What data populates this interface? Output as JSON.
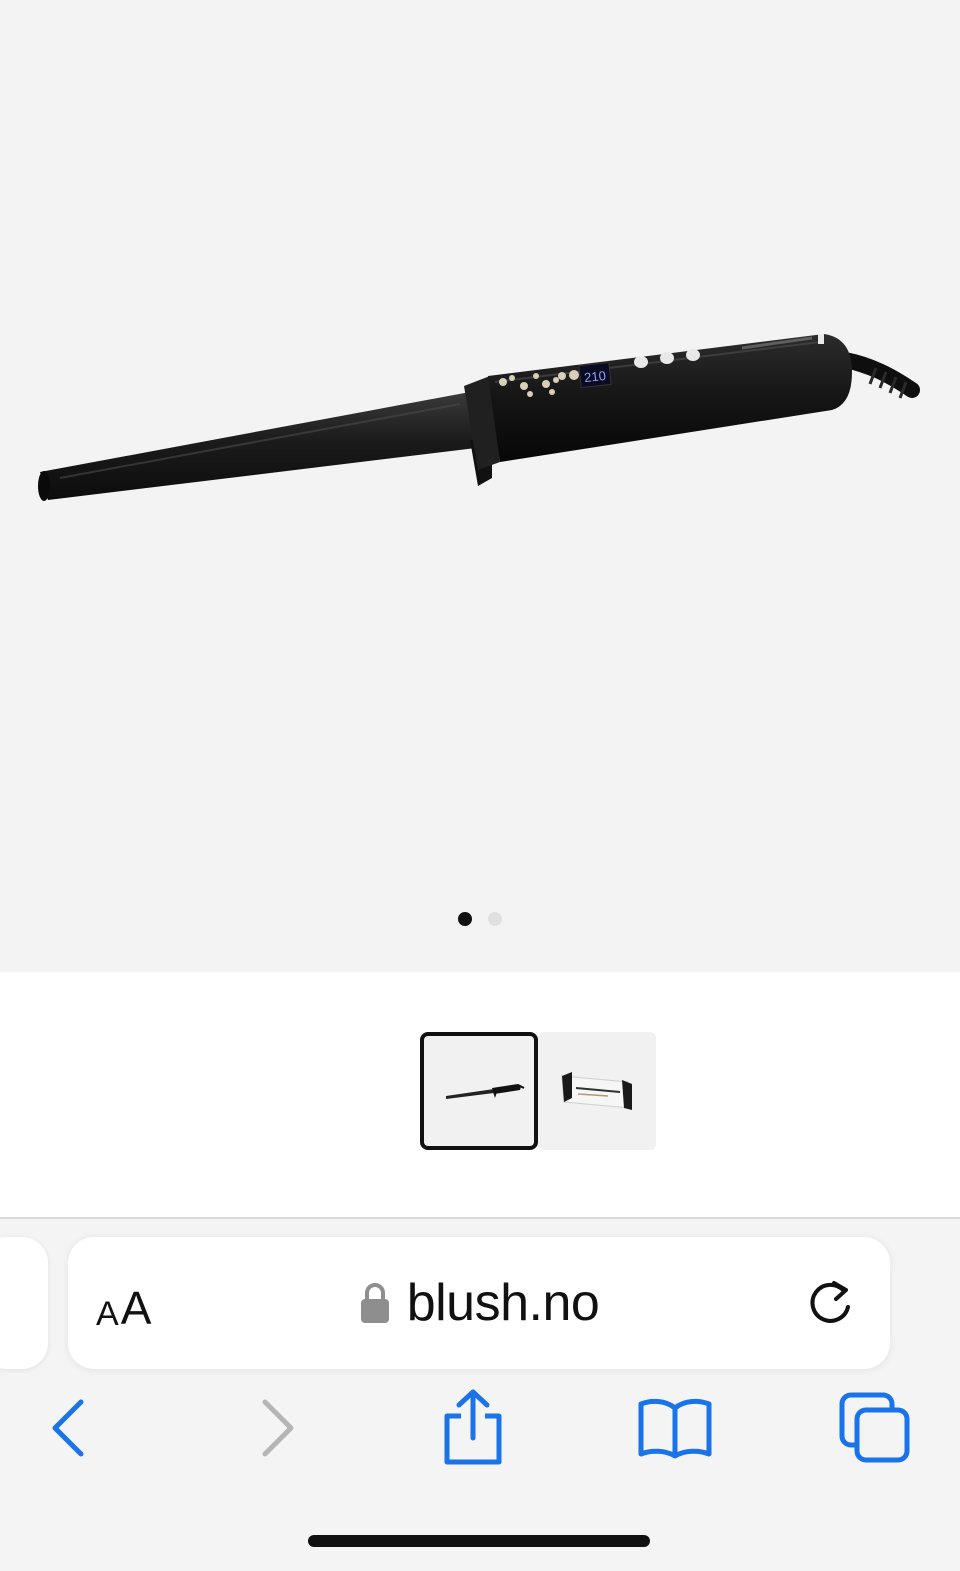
{
  "gallery": {
    "product_image": "curling-wand-photo",
    "slide_count": 2,
    "active_slide": 1
  },
  "thumbnails": [
    {
      "name": "curling-wand-thumbnail",
      "selected": true
    },
    {
      "name": "packaging-box-thumbnail",
      "selected": false
    }
  ],
  "address_bar": {
    "text_size_small": "A",
    "text_size_large": "A",
    "url": "blush.no",
    "secure_icon": "lock-icon",
    "reload_icon": "reload-icon"
  },
  "toolbar": {
    "back_icon": "chevron-left-icon",
    "forward_icon": "chevron-right-icon",
    "share_icon": "share-icon",
    "bookmarks_icon": "book-icon",
    "tabs_icon": "tabs-icon"
  },
  "colors": {
    "accent": "#1a73e8",
    "disabled": "#b5b5b5",
    "product_black": "#1c1c1c"
  }
}
